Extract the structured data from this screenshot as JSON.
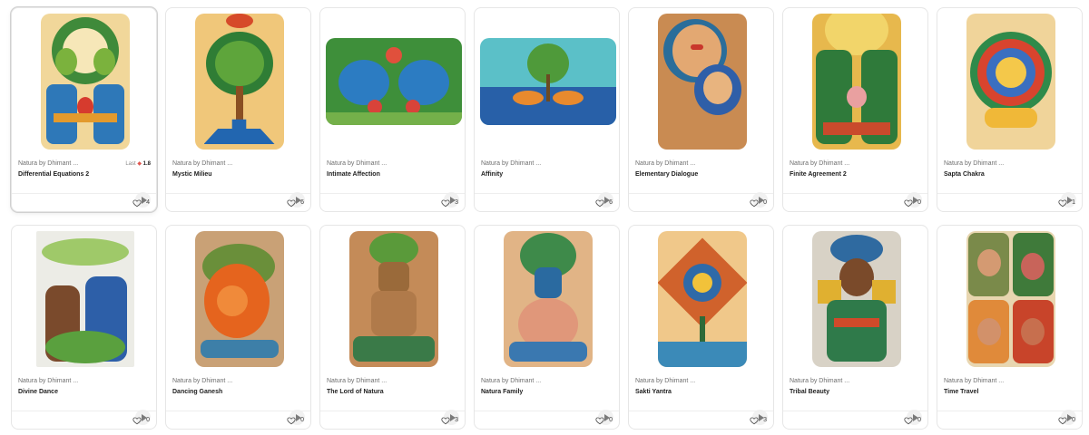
{
  "cards": [
    {
      "creator": "Natura by Dhimant ...",
      "title": "Differential Equations 2",
      "likes": "4",
      "last_label": "Last",
      "last_value": "1.8"
    },
    {
      "creator": "Natura by Dhimant ...",
      "title": "Mystic Milieu",
      "likes": "6"
    },
    {
      "creator": "Natura by Dhimant ...",
      "title": "Intimate Affection",
      "likes": "3"
    },
    {
      "creator": "Natura by Dhimant ...",
      "title": "Affinity",
      "likes": "6"
    },
    {
      "creator": "Natura by Dhimant ...",
      "title": "Elementary Dialogue",
      "likes": "0"
    },
    {
      "creator": "Natura by Dhimant ...",
      "title": "Finite Agreement 2",
      "likes": "0"
    },
    {
      "creator": "Natura by Dhimant ...",
      "title": "Sapta Chakra",
      "likes": "1"
    },
    {
      "creator": "Natura by Dhimant ...",
      "title": "Divine Dance",
      "likes": "0"
    },
    {
      "creator": "Natura by Dhimant ...",
      "title": "Dancing Ganesh",
      "likes": "0"
    },
    {
      "creator": "Natura by Dhimant ...",
      "title": "The Lord of Natura",
      "likes": "3"
    },
    {
      "creator": "Natura by Dhimant ...",
      "title": "Natura Family",
      "likes": "0"
    },
    {
      "creator": "Natura by Dhimant ...",
      "title": "Sakti Yantra",
      "likes": "3"
    },
    {
      "creator": "Natura by Dhimant ...",
      "title": "Tribal Beauty",
      "likes": "0"
    },
    {
      "creator": "Natura by Dhimant ...",
      "title": "Time Travel",
      "likes": "0"
    }
  ],
  "icons": {
    "like": "heart-outline-icon",
    "play": "play-icon",
    "price": "diamond-icon"
  },
  "colors": {
    "price_accent": "#e0564f",
    "border": "#e6e6e6"
  }
}
